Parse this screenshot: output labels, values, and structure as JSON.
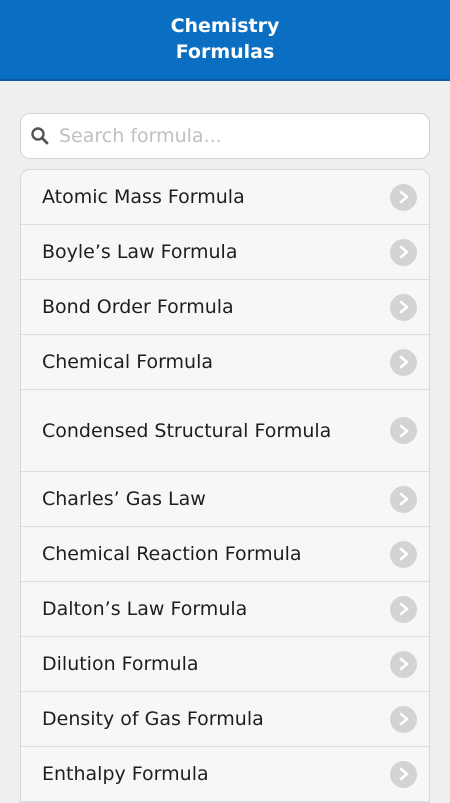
{
  "header": {
    "title": "Chemistry\nFormulas"
  },
  "search": {
    "placeholder": "Search formula..."
  },
  "colors": {
    "accent": "#0a6fc2",
    "background": "#efefef",
    "chevron": "#d3d3d3"
  },
  "list": {
    "items": [
      {
        "label": "Atomic Mass Formula",
        "icon": "chevron-right-icon"
      },
      {
        "label": "Boyle’s Law Formula",
        "icon": "chevron-right-icon"
      },
      {
        "label": "Bond Order Formula",
        "icon": "chevron-right-icon"
      },
      {
        "label": "Chemical Formula",
        "icon": "chevron-right-icon"
      },
      {
        "label": "Condensed Structural Formula",
        "icon": "chevron-right-icon"
      },
      {
        "label": "Charles’ Gas Law",
        "icon": "chevron-right-icon"
      },
      {
        "label": "Chemical Reaction Formula",
        "icon": "chevron-right-icon"
      },
      {
        "label": "Dalton’s Law Formula",
        "icon": "chevron-right-icon"
      },
      {
        "label": "Dilution Formula",
        "icon": "chevron-right-icon"
      },
      {
        "label": "Density of Gas Formula",
        "icon": "chevron-right-icon"
      },
      {
        "label": "Enthalpy Formula",
        "icon": "chevron-right-icon"
      }
    ]
  }
}
